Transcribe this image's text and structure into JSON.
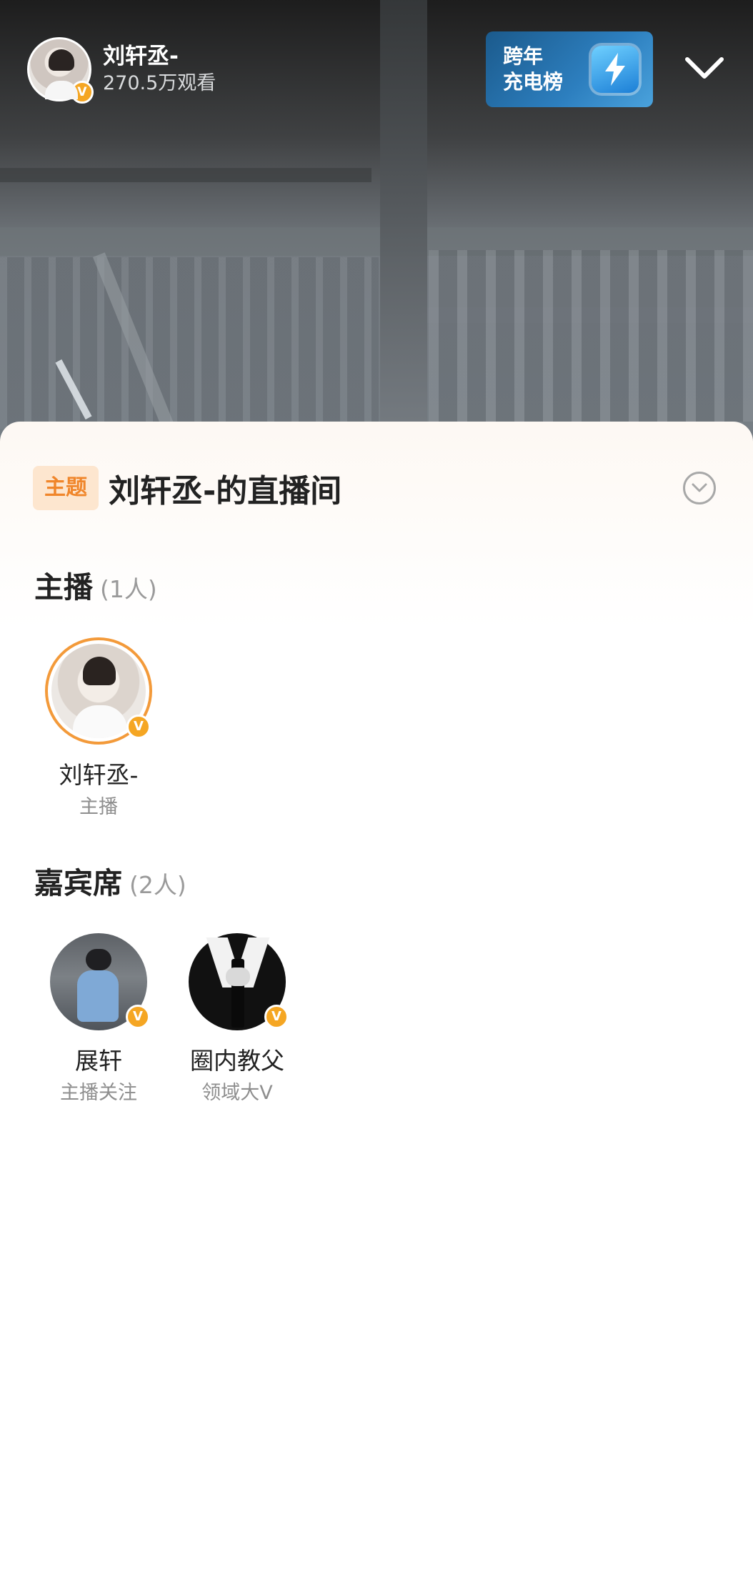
{
  "header": {
    "host_name": "刘轩丞-",
    "viewers": "270.5万观看",
    "verified_badge": "V",
    "charge_board": {
      "line1": "跨年",
      "line2": "充电榜"
    },
    "icons": {
      "lightning": "lightning-icon",
      "collapse": "chevron-down-icon"
    }
  },
  "sheet": {
    "topic_tag": "主题",
    "topic_title": "刘轩丞-的直播间",
    "host_section": {
      "title": "主播",
      "count": "(1人)"
    },
    "hosts": [
      {
        "name": "刘轩丞-",
        "role": "主播"
      }
    ],
    "guest_section": {
      "title": "嘉宾席",
      "count": "(2人)"
    },
    "guests": [
      {
        "name": "展轩",
        "role": "主播关注"
      },
      {
        "name": "圈内教父",
        "role": "领域大V"
      }
    ]
  },
  "colors": {
    "accent_orange": "#f39a3a",
    "badge_orange": "#f5a623",
    "tag_bg": "#fde6cf",
    "charge_blue": "#2d7fbf"
  }
}
